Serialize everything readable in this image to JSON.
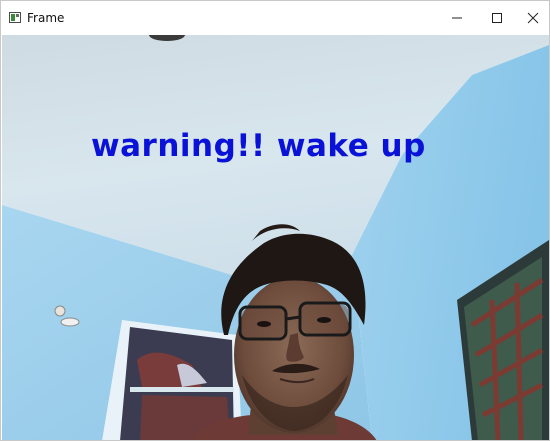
{
  "window": {
    "title": "Frame",
    "icon": "opencv-window-icon",
    "controls": [
      "minimize-icon",
      "maximize-icon",
      "close-icon"
    ]
  },
  "frame": {
    "overlay_text": "warning!! wake up",
    "overlay_color": "#0a12d8"
  }
}
